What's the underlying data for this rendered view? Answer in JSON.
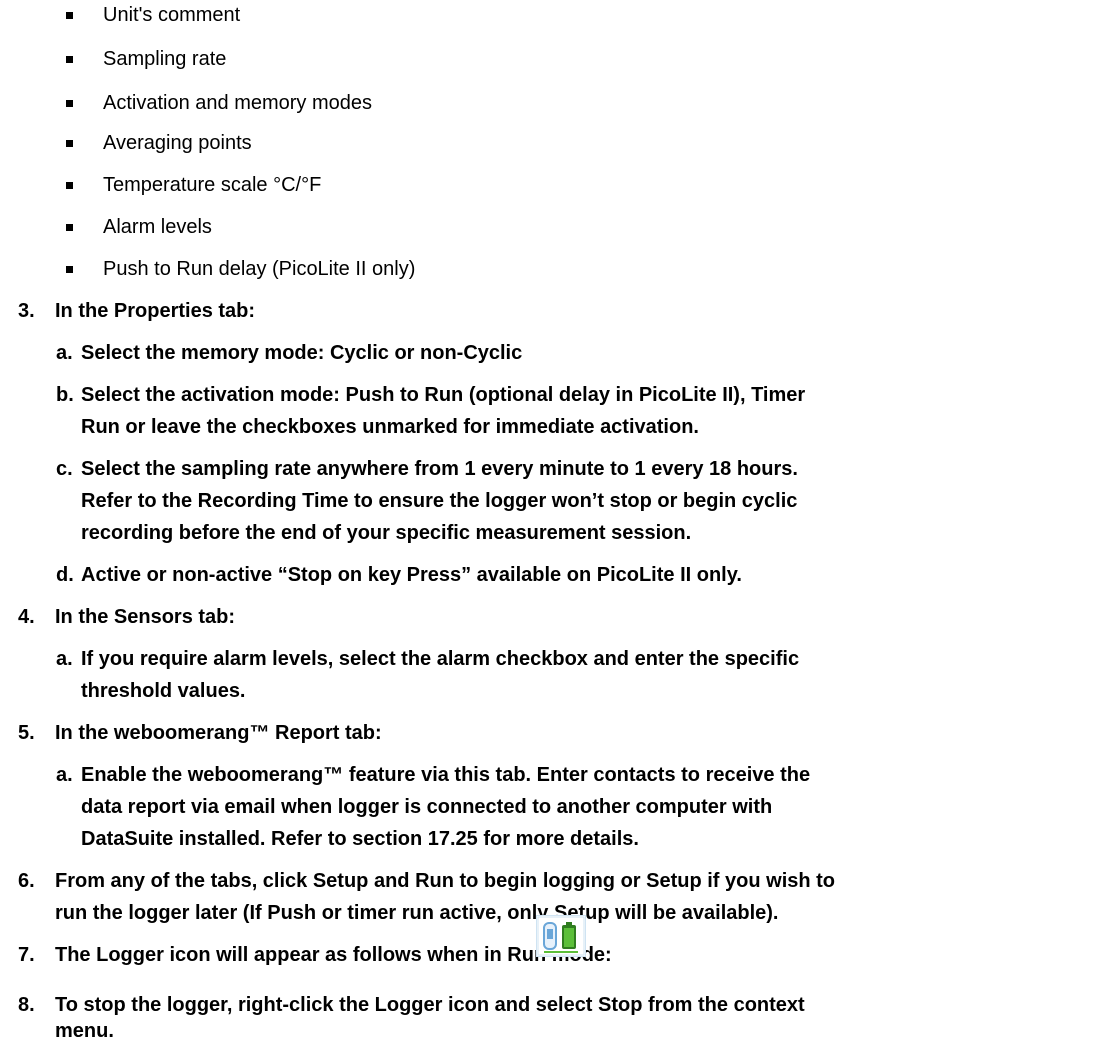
{
  "bullets": [
    "Unit's comment",
    "Sampling rate",
    "Activation and memory modes",
    "Averaging points",
    "Temperature scale °C/°F",
    "Alarm levels",
    "Push to Run delay (PicoLite II only)"
  ],
  "steps": {
    "s3": {
      "num": "3.",
      "text": "In the Properties tab:",
      "subs": [
        {
          "letter": "a.",
          "lines": [
            "Select the memory mode: Cyclic or non-Cyclic"
          ]
        },
        {
          "letter": "b.",
          "lines": [
            "Select the activation mode: Push to Run (optional delay in PicoLite II), Timer",
            "Run or leave the checkboxes unmarked for immediate activation."
          ]
        },
        {
          "letter": "c.",
          "lines": [
            "Select the sampling rate anywhere from 1 every minute to 1 every 18 hours.",
            "Refer to the Recording Time to ensure the logger won’t stop or begin cyclic",
            "recording before the end of your specific measurement session."
          ]
        },
        {
          "letter": "d.",
          "lines": [
            "Active or non-active “Stop on key Press” available on PicoLite II only."
          ]
        }
      ]
    },
    "s4": {
      "num": "4.",
      "text": "In the Sensors tab:",
      "subs": [
        {
          "letter": "a.",
          "lines": [
            "If you require alarm levels, select the alarm checkbox and enter the specific",
            "threshold values."
          ]
        }
      ]
    },
    "s5": {
      "num": "5.",
      "text": "In the weboomerang™ Report tab:",
      "subs": [
        {
          "letter": "a.",
          "lines": [
            "Enable the weboomerang™ feature via this tab. Enter contacts to receive the",
            "data report via email when logger is connected to another computer with",
            "DataSuite installed. Refer to section 17.25 for more details."
          ]
        }
      ]
    },
    "s6": {
      "num": "6.",
      "lines": [
        "From any of the tabs, click Setup and Run to begin logging or Setup if you wish to",
        "run the logger later (If Push or timer run active, only Setup will be available)."
      ]
    },
    "s7": {
      "num": "7.",
      "text": "The Logger icon will appear as follows when in Run mode:"
    },
    "s8": {
      "num": "8.",
      "lines": [
        "To stop the logger, right-click the Logger icon and select Stop from the context",
        "menu."
      ]
    }
  },
  "logger_icon": {
    "icon": "logger-battery-icon",
    "colors": {
      "device": "#6aa6d8",
      "battery": "#5cbf3a",
      "frame": "#cfe3f2"
    }
  }
}
